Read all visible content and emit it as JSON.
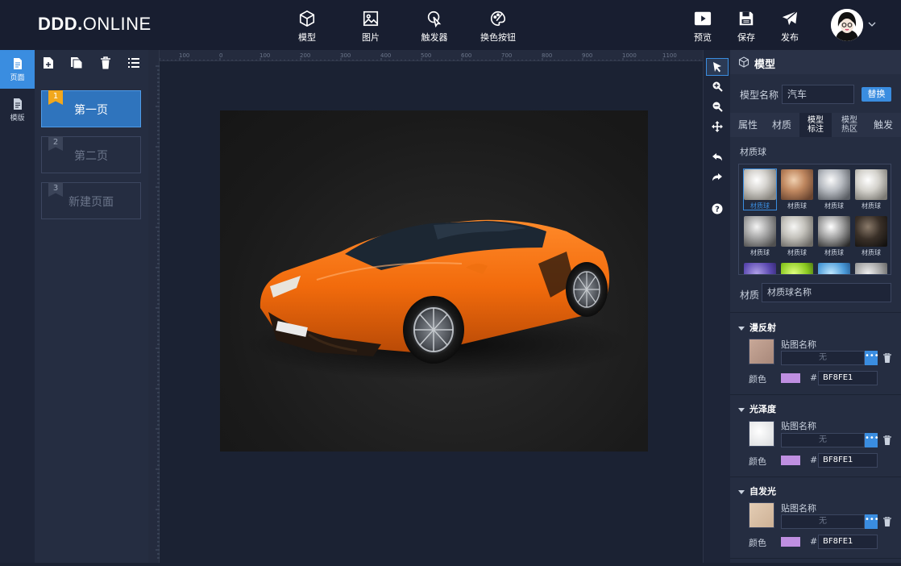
{
  "app": {
    "logo_bold": "DDD.",
    "logo_light": "ONLINE"
  },
  "topbar": {
    "tools": [
      {
        "label": "模型",
        "icon": "cube-icon"
      },
      {
        "label": "图片",
        "icon": "image-icon"
      },
      {
        "label": "触发器",
        "icon": "pointer-click-icon"
      },
      {
        "label": "换色按钮",
        "icon": "palette-icon"
      }
    ],
    "actions": [
      {
        "label": "预览",
        "icon": "play-icon"
      },
      {
        "label": "保存",
        "icon": "save-icon"
      },
      {
        "label": "发布",
        "icon": "send-icon"
      }
    ]
  },
  "leftnav": {
    "page_label": "页面",
    "template_label": "模版"
  },
  "pages": [
    {
      "num": "1",
      "name": "第一页",
      "active": true
    },
    {
      "num": "2",
      "name": "第二页",
      "active": false
    },
    {
      "num": "3",
      "name": "新建页面",
      "active": false
    }
  ],
  "ruler": {
    "h_ticks": [
      "100",
      "0",
      "100",
      "200",
      "300",
      "400",
      "500",
      "600",
      "700",
      "800",
      "900",
      "1000",
      "1100"
    ]
  },
  "rightpanel": {
    "title": "模型",
    "model_name_label": "模型名称",
    "model_name_value": "汽车",
    "replace_label": "替换",
    "tabs": [
      "属性",
      "材质",
      "模型\n标注",
      "模型\n热区",
      "触发"
    ],
    "active_tab": "材质",
    "material_ball_label": "材质球",
    "balls": [
      "材质球",
      "材质球",
      "材质球",
      "材质球",
      "材质球",
      "材质球",
      "材质球",
      "材质球"
    ],
    "material_label": "材质",
    "material_value": "材质球名称",
    "sections": [
      {
        "title": "漫反射",
        "map_label": "贴图名称",
        "map_value": "无",
        "color_label": "颜色",
        "hash": "#",
        "hex": "BF8FE1"
      },
      {
        "title": "光泽度",
        "map_label": "贴图名称",
        "map_value": "无",
        "color_label": "颜色",
        "hash": "#",
        "hex": "BF8FE1"
      },
      {
        "title": "自发光",
        "map_label": "贴图名称",
        "map_value": "无",
        "color_label": "颜色",
        "hash": "#",
        "hex": "BF8FE1"
      }
    ]
  },
  "colors": {
    "accent": "#3a8de0",
    "swatch": "#BF8FE1",
    "active_flag": "#f2a81d"
  }
}
